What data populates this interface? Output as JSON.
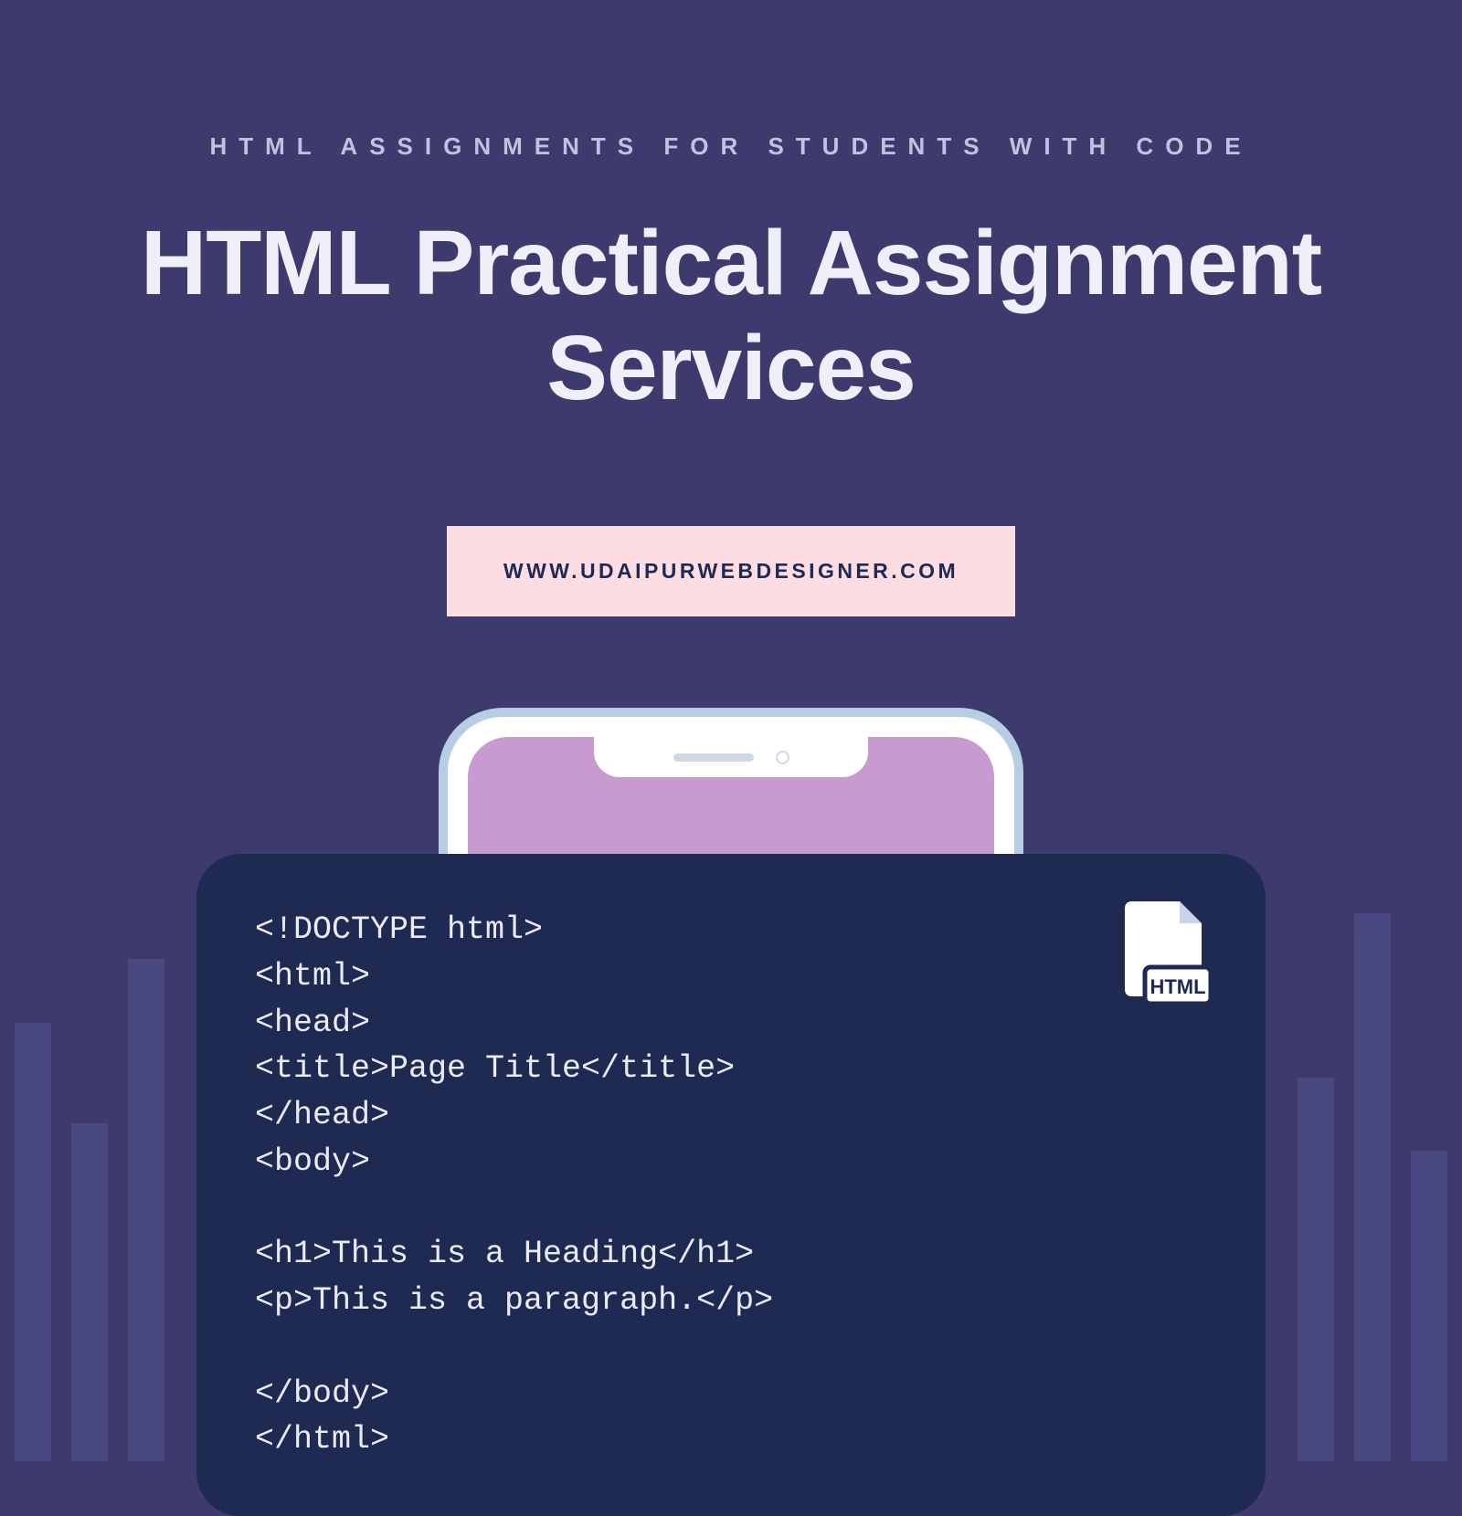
{
  "eyebrow": "HTML ASSIGNMENTS FOR STUDENTS WITH CODE",
  "title": "HTML Practical Assignment Services",
  "url": "WWW.UDAIPURWEBDESIGNER.COM",
  "code": "<!DOCTYPE html>\n<html>\n<head>\n<title>Page Title</title>\n</head>\n<body>\n\n<h1>This is a Heading</h1>\n<p>This is a paragraph.</p>\n\n</body>\n</html>",
  "icon_label": "HTML"
}
